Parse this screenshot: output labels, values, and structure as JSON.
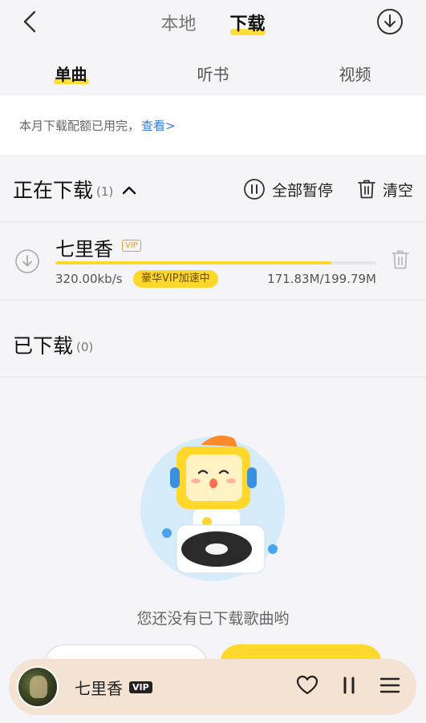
{
  "header": {
    "tabs": [
      {
        "label": "本地",
        "active": false
      },
      {
        "label": "下载",
        "active": true
      }
    ]
  },
  "sub_tabs": [
    {
      "label": "单曲",
      "active": true
    },
    {
      "label": "听书",
      "active": false
    },
    {
      "label": "视频",
      "active": false
    }
  ],
  "notice": {
    "text": "本月下载配额已用完，",
    "link": "查看>"
  },
  "downloading": {
    "title": "正在下载",
    "count": "(1)",
    "pause_all": "全部暂停",
    "clear": "清空",
    "items": [
      {
        "title": "七里香",
        "vip_tag": "VIP",
        "speed": "320.00kb/s",
        "accel_badge": "豪华VIP加速中",
        "size": "171.83M/199.79M",
        "progress": 0.86
      }
    ]
  },
  "downloaded": {
    "title": "已下载",
    "count": "(0)",
    "empty_text": "您还没有已下载歌曲哟"
  },
  "player": {
    "title": "七里香",
    "vip": "VIP"
  },
  "colors": {
    "accent_yellow": "#ffd82b",
    "link_blue": "#3b7be0",
    "player_bg": "#f4e2d3"
  }
}
